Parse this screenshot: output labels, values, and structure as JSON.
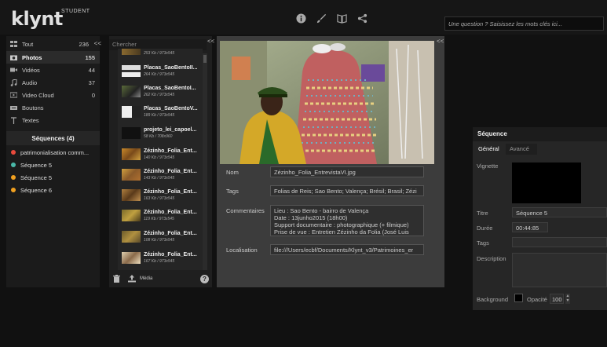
{
  "app": {
    "name": "klynt",
    "edition": "STUDENT"
  },
  "toolbar": {
    "icons": [
      "info-icon",
      "brush-icon",
      "book-icon",
      "share-icon"
    ]
  },
  "search": {
    "placeholder": "Une question ? Saisissez les mots clés ici..."
  },
  "library": {
    "categories": [
      {
        "label": "Tout",
        "count": "236",
        "icon": "grid-icon",
        "collapse": "<<"
      },
      {
        "label": "Photos",
        "count": "155",
        "icon": "camera-icon"
      },
      {
        "label": "Vidéos",
        "count": "44",
        "icon": "video-icon"
      },
      {
        "label": "Audio",
        "count": "37",
        "icon": "music-icon"
      },
      {
        "label": "Video Cloud",
        "count": "0",
        "icon": "cloud-video-icon"
      },
      {
        "label": "Boutons",
        "count": "",
        "icon": "button-icon"
      },
      {
        "label": "Textes",
        "count": "",
        "icon": "text-icon"
      }
    ],
    "sequences_header": "Séquences (4)",
    "sequences": [
      {
        "label": "patrimonialisation comm...",
        "color": "#e84a3c"
      },
      {
        "label": "Séquence 5",
        "color": "#4ab8a8"
      },
      {
        "label": "Séquence 5",
        "color": "#f0a020"
      },
      {
        "label": "Séquence 6",
        "color": "#f0a020"
      }
    ]
  },
  "files": {
    "search_placeholder": "Chercher",
    "collapse": "<<",
    "items": [
      {
        "name": "",
        "meta": "253 Kb / 973x545"
      },
      {
        "name": "Placas_SaoBentoII...",
        "meta": "264 Kb / 973x545"
      },
      {
        "name": "Placas_SaoBentoI...",
        "meta": "262 Kb / 973x545"
      },
      {
        "name": "Placas_SaoBentoV...",
        "meta": "189 Kb / 973x545"
      },
      {
        "name": "projeto_lei_capoel...",
        "meta": "58 Kb / 708x960"
      },
      {
        "name": "Zézinho_Folia_Ent...",
        "meta": "140 Kb / 973x545"
      },
      {
        "name": "Zézinho_Folia_Ent...",
        "meta": "143 Kb / 973x545"
      },
      {
        "name": "Zézinho_Folia_Ent...",
        "meta": "163 Kb / 973x545"
      },
      {
        "name": "Zézinho_Folia_Ent...",
        "meta": "119 Kb / 973x545"
      },
      {
        "name": "Zézinho_Folia_Ent...",
        "meta": "108 Kb / 973x545"
      },
      {
        "name": "Zézinho_Folia_Ent...",
        "meta": "167 Kb / 973x545"
      }
    ],
    "bottom": {
      "media_label": "Média",
      "help": "?"
    }
  },
  "detail": {
    "collapse": "<<",
    "fields": {
      "nom_label": "Nom",
      "nom": "Zézinho_Folia_EntrevistaVI.jpg",
      "tags_label": "Tags",
      "tags": "Folias de Reis; Sao Bento; Valença; Brésil; Brasil; Zézi",
      "commentaires_label": "Commentaires",
      "commentaires": "Lieu : Sao Bento - bairro de Valença\nDate : 13junho2015 (18h00)\nSupport documentaire : photographique (+ filmique)\nPrise de vue : Entretien Zézinho da Folia (José Luis Ferreira)",
      "localisation_label": "Localisation",
      "localisation": "file:///Users/ecbf/Documents/Klynt_v3/Patrimoines_er"
    }
  },
  "sequence_panel": {
    "title": "Séquence",
    "tabs": [
      "Général",
      "Avancé"
    ],
    "vignette_label": "Vignette",
    "titre_label": "Titre",
    "titre": "Séquence 5",
    "duree_label": "Durée",
    "duree": "00:44:85",
    "tags_label": "Tags",
    "description_label": "Description",
    "background_label": "Background",
    "opacite_label": "Opacité",
    "opacite": "100"
  }
}
